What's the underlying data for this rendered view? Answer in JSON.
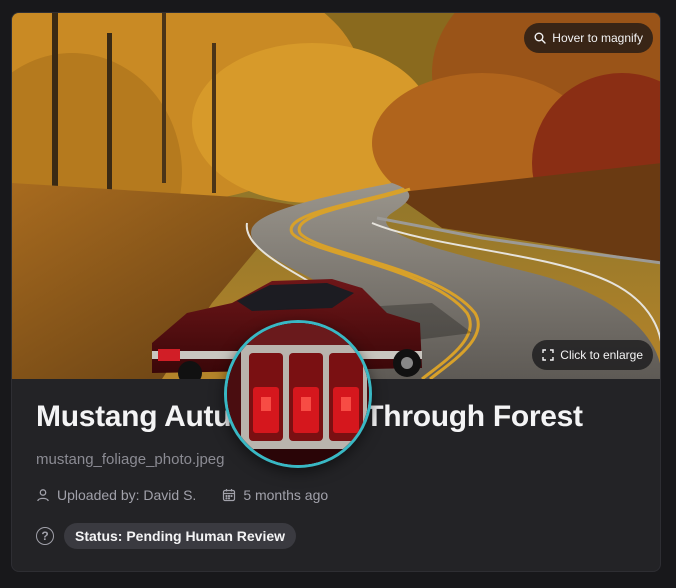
{
  "photo": {
    "alt": "Red Mustang driving on a winding road through an autumn forest",
    "magnify_label": "Hover to magnify",
    "enlarge_label": "Click to enlarge"
  },
  "details": {
    "title": "Mustang Autumn Drive Through Forest",
    "filename": "mustang_foliage_photo.jpeg",
    "uploaded_by": "Uploaded by: David S.",
    "uploaded_ago": "5 months ago",
    "status": "Status: Pending Human Review"
  },
  "icons": {
    "magnify": "search-icon",
    "enlarge": "expand-icon",
    "user": "user-icon",
    "date": "calendar-icon",
    "help": "help-icon"
  },
  "colors": {
    "page_bg": "#18181b",
    "card_bg": "#232326",
    "magnifier_ring": "#39b8c4",
    "badge_bg": "#3a3a40"
  }
}
